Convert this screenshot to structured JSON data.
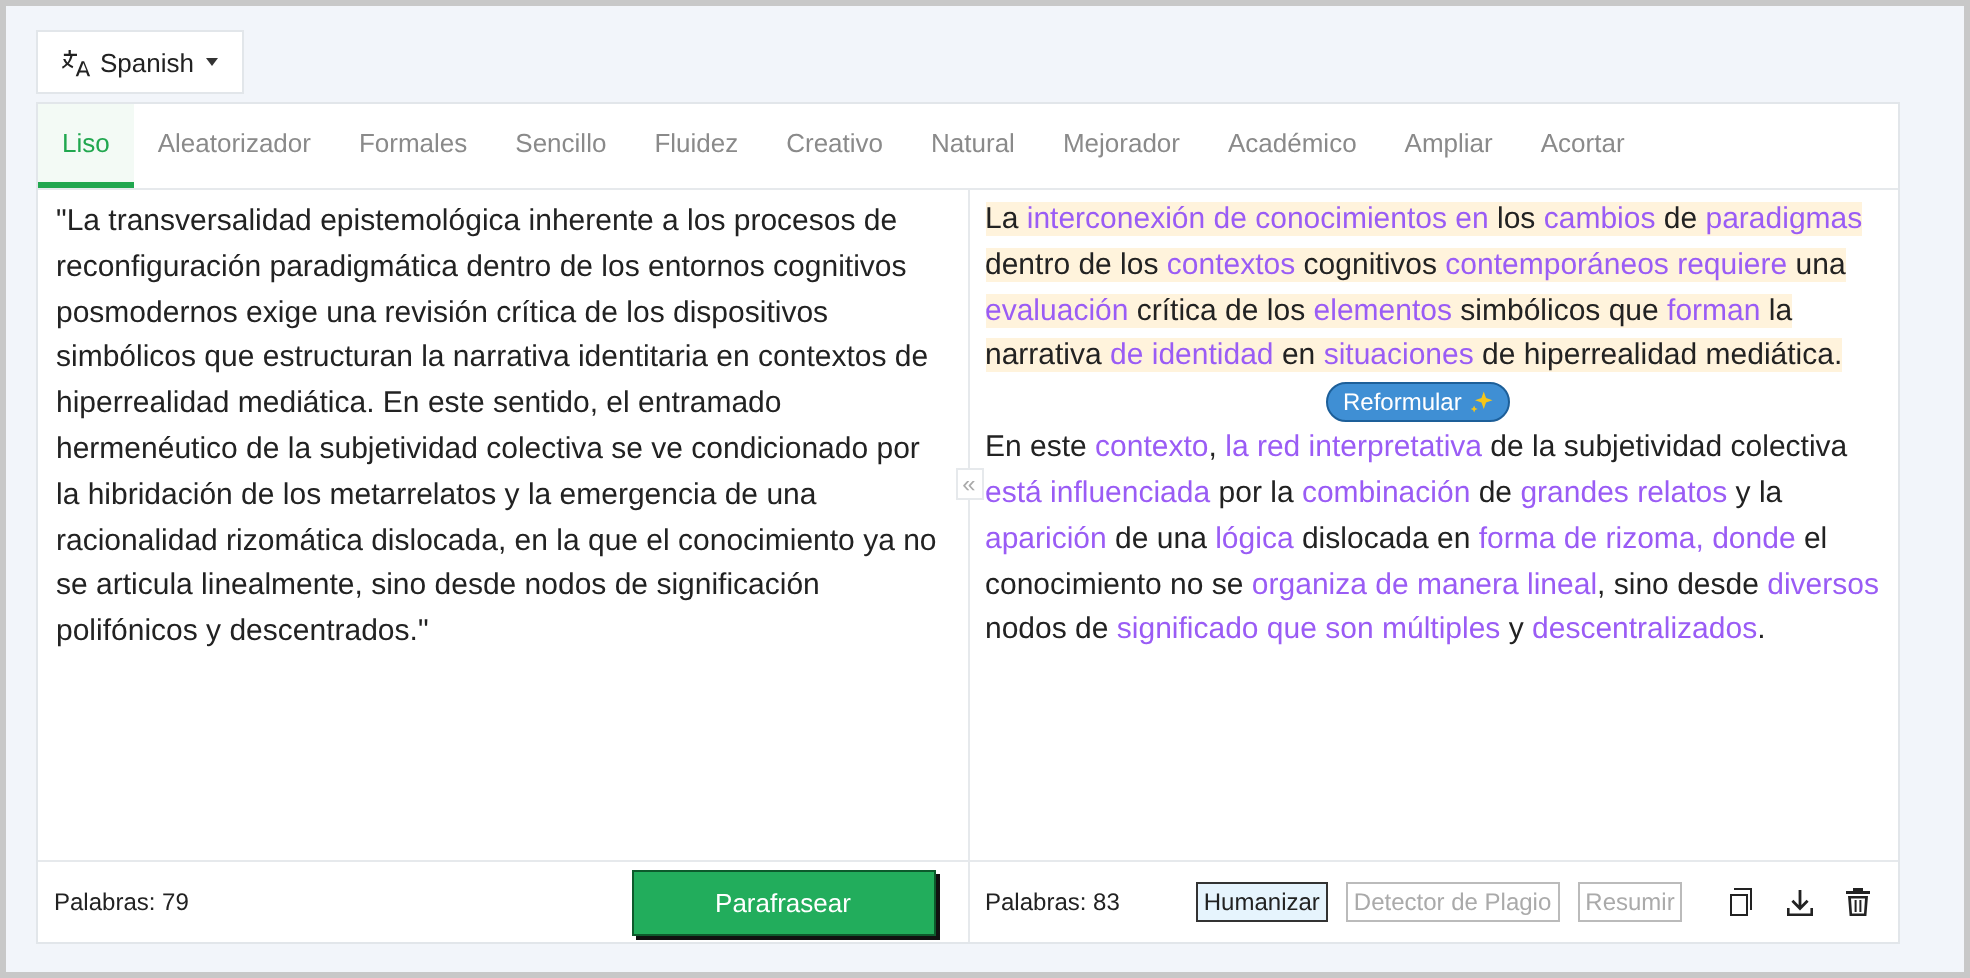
{
  "language_button": {
    "label": "Spanish"
  },
  "tabs": [
    {
      "label": "Liso",
      "selected": true
    },
    {
      "label": "Aleatorizador",
      "selected": false
    },
    {
      "label": "Formales",
      "selected": false
    },
    {
      "label": "Sencillo",
      "selected": false
    },
    {
      "label": "Fluidez",
      "selected": false
    },
    {
      "label": "Creativo",
      "selected": false
    },
    {
      "label": "Natural",
      "selected": false
    },
    {
      "label": "Mejorador",
      "selected": false
    },
    {
      "label": "Académico",
      "selected": false
    },
    {
      "label": "Ampliar",
      "selected": false
    },
    {
      "label": "Acortar",
      "selected": false
    }
  ],
  "input": {
    "text": "\"La transversalidad epistemológica inherente a los procesos de reconfiguración paradigmática dentro de los entornos cognitivos posmodernos exige una revisión crítica de los dispositivos simbólicos que estructuran la narrativa identitaria en contextos de hiperrealidad mediática. En este sentido, el entramado hermenéutico de la subjetividad colectiva se ve condicionado por la hibridación de los metarrelatos y la emergencia de una racionalidad rizomática dislocada, en la que el conocimiento ya no se articula linealmente, sino desde nodos de significación polifónicos y descentrados.\"",
    "word_count": "Palabras: 79"
  },
  "collapse_toggle": "«",
  "paraphrase_button": "Parafrasear",
  "output": {
    "sentences": [
      {
        "highlighted": true,
        "segments": [
          {
            "text": "La ",
            "changed": false
          },
          {
            "text": "interconexión de conocimientos en",
            "changed": true
          },
          {
            "text": " los ",
            "changed": false
          },
          {
            "text": "cambios",
            "changed": true
          },
          {
            "text": " de ",
            "changed": false
          },
          {
            "text": "paradigmas",
            "changed": true
          },
          {
            "text": " dentro de los ",
            "changed": false
          },
          {
            "text": "contextos",
            "changed": true
          },
          {
            "text": " cognitivos ",
            "changed": false
          },
          {
            "text": "contemporáneos requiere",
            "changed": true
          },
          {
            "text": " una ",
            "changed": false
          },
          {
            "text": "evaluación",
            "changed": true
          },
          {
            "text": " crítica de los ",
            "changed": false
          },
          {
            "text": "elementos",
            "changed": true
          },
          {
            "text": " simbólicos que ",
            "changed": false
          },
          {
            "text": "forman",
            "changed": true
          },
          {
            "text": " la narrativa ",
            "changed": false
          },
          {
            "text": "de identidad",
            "changed": true
          },
          {
            "text": " en ",
            "changed": false
          },
          {
            "text": "situaciones",
            "changed": true
          },
          {
            "text": " de hiperrealidad mediática.",
            "changed": false
          }
        ]
      },
      {
        "highlighted": false,
        "segments": [
          {
            "text": "En este ",
            "changed": false
          },
          {
            "text": "contexto",
            "changed": true
          },
          {
            "text": ", ",
            "changed": false
          },
          {
            "text": "la red interpretativa",
            "changed": true
          },
          {
            "text": " de la subjetividad colectiva ",
            "changed": false
          },
          {
            "text": "está influenciada",
            "changed": true
          },
          {
            "text": " por la ",
            "changed": false
          },
          {
            "text": "combinación",
            "changed": true
          },
          {
            "text": " de ",
            "changed": false
          },
          {
            "text": "grandes relatos",
            "changed": true
          },
          {
            "text": " y la ",
            "changed": false
          },
          {
            "text": "aparición",
            "changed": true
          },
          {
            "text": " de una ",
            "changed": false
          },
          {
            "text": "lógica",
            "changed": true
          },
          {
            "text": " dislocada en ",
            "changed": false
          },
          {
            "text": "forma de rizoma, donde",
            "changed": true
          },
          {
            "text": " el conocimiento no se ",
            "changed": false
          },
          {
            "text": "organiza de manera lineal",
            "changed": true
          },
          {
            "text": ", sino desde ",
            "changed": false
          },
          {
            "text": "diversos",
            "changed": true
          },
          {
            "text": " nodos de ",
            "changed": false
          },
          {
            "text": "significado que son múltiples",
            "changed": true
          },
          {
            "text": " y ",
            "changed": false
          },
          {
            "text": "descentralizados",
            "changed": true
          },
          {
            "text": ".",
            "changed": false
          }
        ]
      }
    ],
    "tooltip": "Reformular",
    "word_count": "Palabras: 83",
    "actions": [
      {
        "label": "Humanizar",
        "selected": true
      },
      {
        "label": "Detector de Plagio",
        "selected": false
      },
      {
        "label": "Resumir",
        "selected": false
      }
    ]
  }
}
